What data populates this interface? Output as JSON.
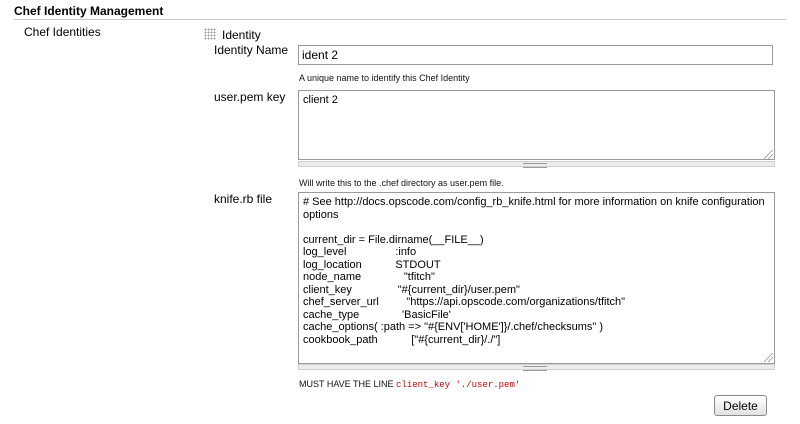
{
  "section": {
    "title": "Chef Identity Management"
  },
  "form": {
    "row_label": "Chef Identities",
    "group_label": "Identity",
    "fields": {
      "identity_name": {
        "label": "Identity Name",
        "value": "ident 2",
        "description": "A unique name to identify this Chef Identity"
      },
      "user_pem": {
        "label": "user.pem key",
        "value": "client 2",
        "description": "Will write this to the .chef directory as user.pem file."
      },
      "knife_rb": {
        "label": "knife.rb file",
        "value": "# See http://docs.opscode.com/config_rb_knife.html for more information on knife configuration options\n\ncurrent_dir = File.dirname(__FILE__)\nlog_level                :info\nlog_location           STDOUT\nnode_name              \"tfitch\"\nclient_key               \"#{current_dir}/user.pem\"\nchef_server_url         \"https://api.opscode.com/organizations/tfitch\"\ncache_type              'BasicFile'\ncache_options( :path => \"#{ENV['HOME']}/.chef/checksums\" )\ncookbook_path           [\"#{current_dir}/./\"]",
        "description_prefix": "MUST HAVE THE LINE ",
        "description_code": "client_key './user.pem'"
      }
    },
    "delete_label": "Delete"
  },
  "icons": {
    "drag_handle": "drag-handle-icon",
    "resize": "resize-grip-icon"
  }
}
